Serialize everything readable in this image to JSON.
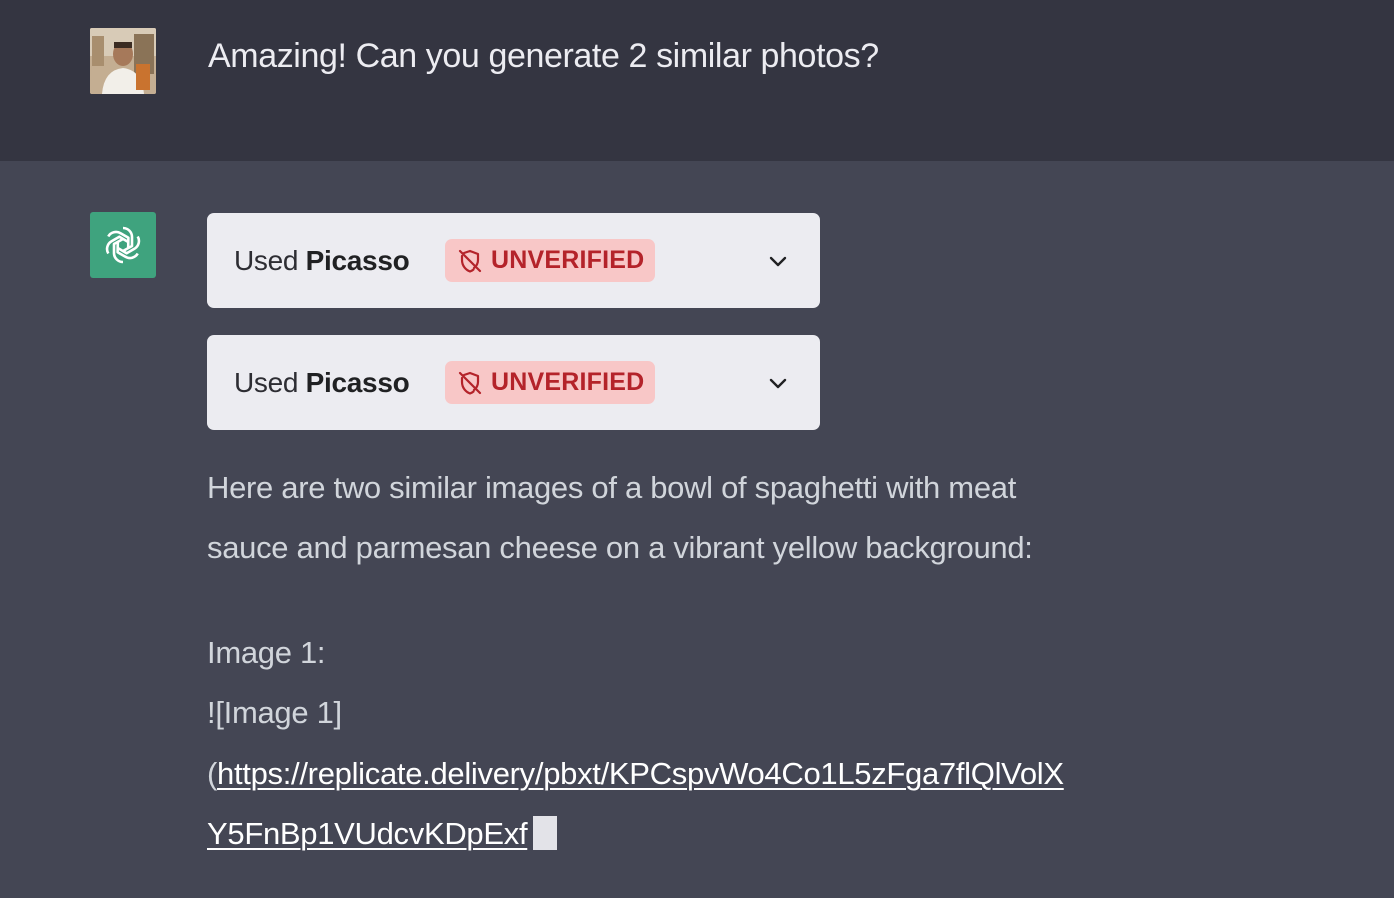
{
  "user": {
    "avatar_icon": "user-photo-avatar",
    "message": "Amazing! Can you generate 2 similar photos?"
  },
  "assistant": {
    "avatar_icon": "openai-logo-icon",
    "avatar_color": "#3fa37e",
    "plugin_calls": [
      {
        "used_prefix": "Used",
        "plugin_name": "Picasso",
        "badge_icon": "shield-off-icon",
        "badge_label": "UNVERIFIED",
        "expand_icon": "chevron-down-icon"
      },
      {
        "used_prefix": "Used",
        "plugin_name": "Picasso",
        "badge_icon": "shield-off-icon",
        "badge_label": "UNVERIFIED",
        "expand_icon": "chevron-down-icon"
      }
    ],
    "response": {
      "line1": "Here are two similar images of a bowl of spaghetti with meat",
      "line2": "sauce and parmesan cheese on a vibrant yellow background:",
      "image_heading": "Image 1:",
      "image_markdown_alt": "![Image 1]",
      "link_open_paren": "(",
      "link_part1": "https://replicate.delivery/pbxt/KPCspvWo4Co1L5zFga7flQlVolX",
      "link_part2": "Y5FnBp1VUdcvKDpExf"
    }
  },
  "colors": {
    "user_bg": "#343541",
    "assistant_bg": "#444654",
    "badge_bg": "#f8c7c7",
    "badge_text": "#b4232a"
  }
}
